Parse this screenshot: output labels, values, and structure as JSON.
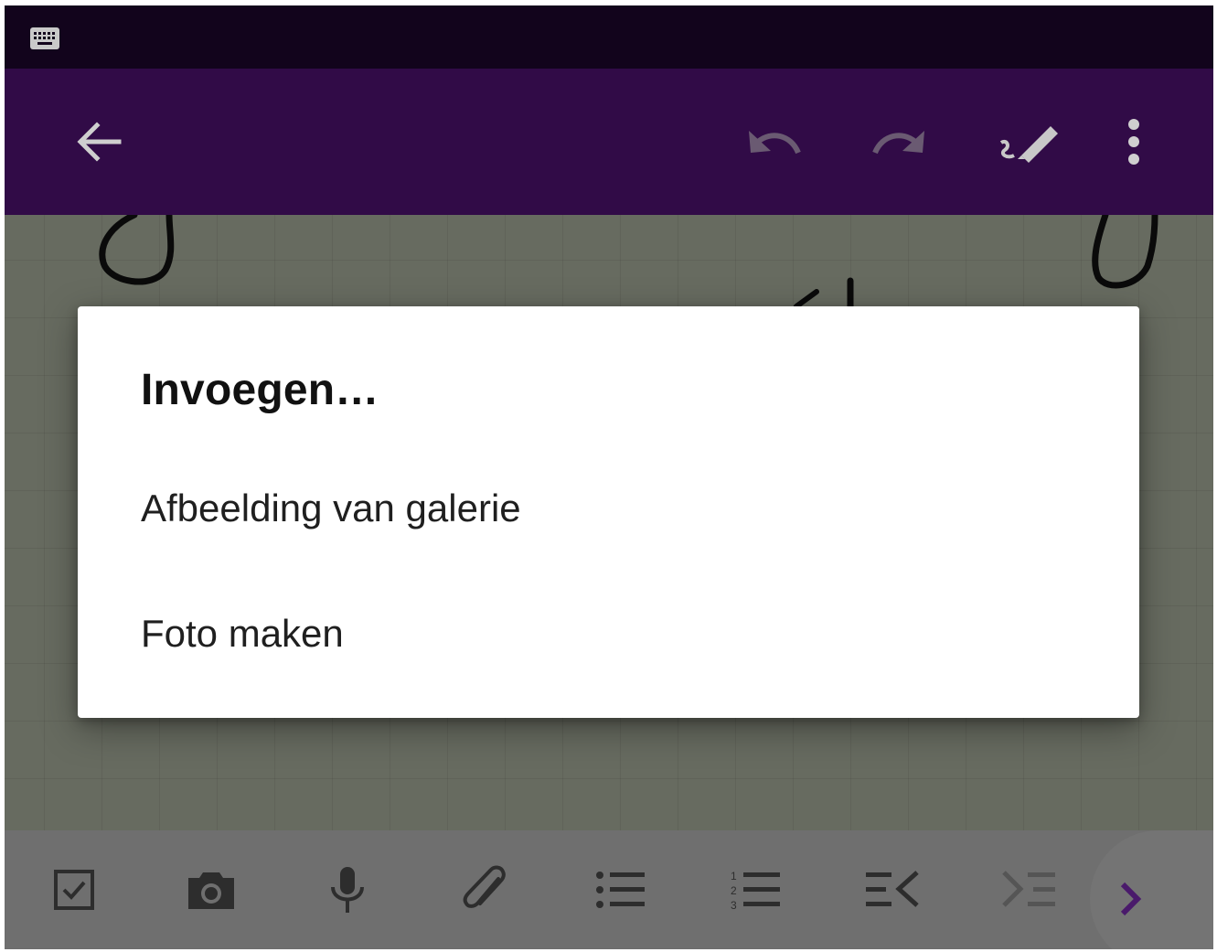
{
  "status_bar": {
    "icon": "keyboard-icon"
  },
  "app_bar": {
    "background": "#310b47",
    "icons": [
      "back-arrow-icon",
      "undo-icon",
      "redo-icon",
      "pen-icon",
      "more-vert-icon"
    ]
  },
  "dialog": {
    "title": "Invoegen…",
    "options": [
      "Afbeelding van galerie",
      "Foto maken"
    ]
  },
  "bottom_toolbar": {
    "icons": [
      "checkbox-icon",
      "camera-icon",
      "mic-icon",
      "paperclip-icon",
      "bulleted-list-icon",
      "numbered-list-icon",
      "outdent-icon",
      "indent-icon",
      "chevron-right-icon"
    ],
    "accent": "#4a1a6b"
  }
}
